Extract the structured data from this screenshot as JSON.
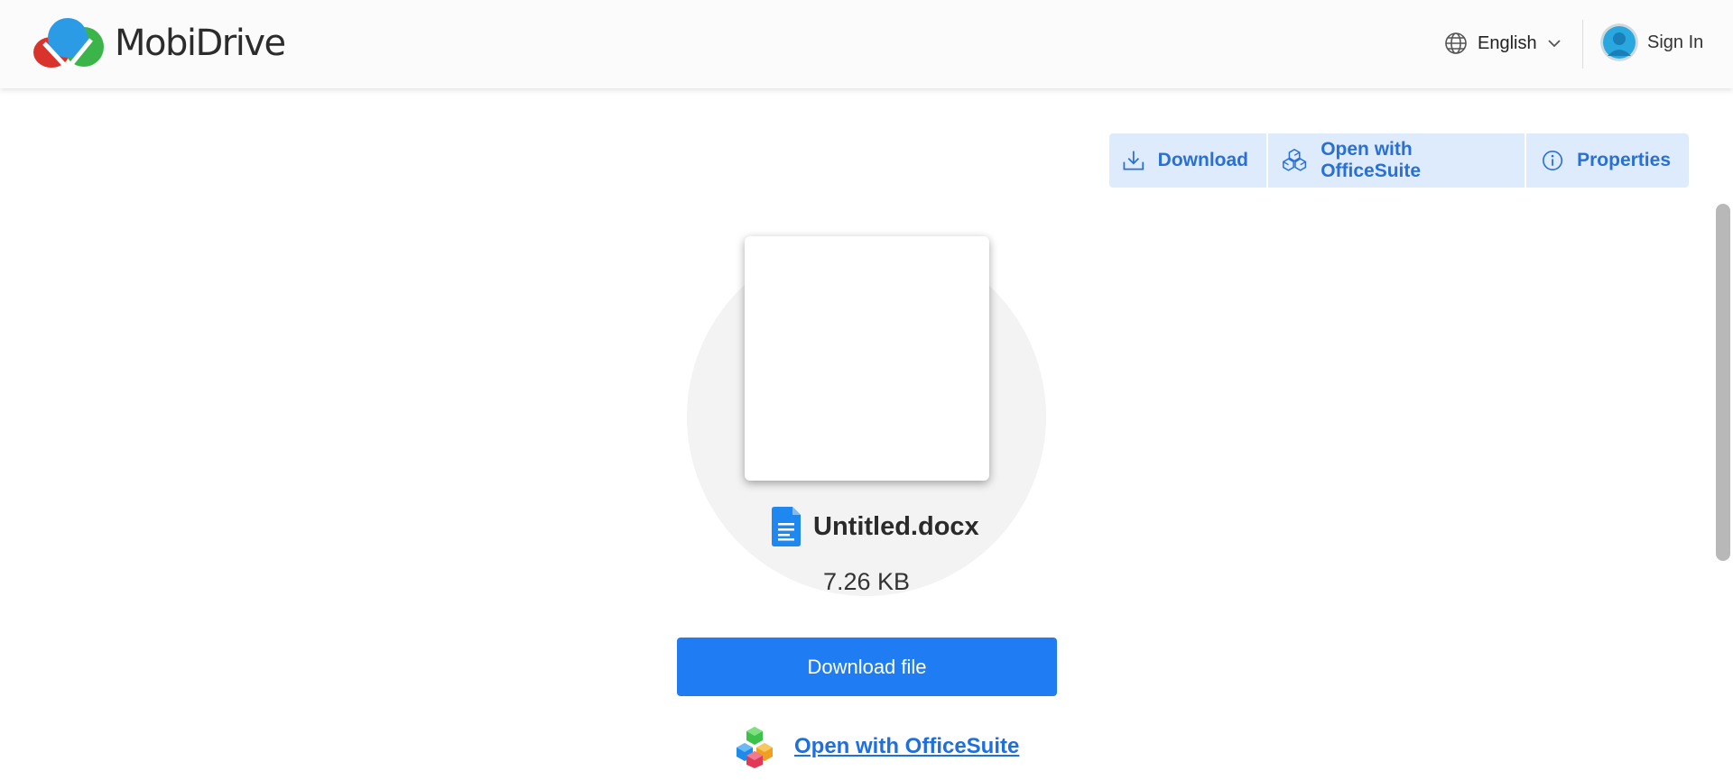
{
  "header": {
    "brand": "MobiDrive",
    "language": "English",
    "sign_in": "Sign In"
  },
  "toolbar": {
    "download": "Download",
    "open_with": "Open with OfficeSuite",
    "properties": "Properties"
  },
  "file": {
    "name": "Untitled.docx",
    "size": "7.26 KB"
  },
  "actions": {
    "download_file": "Download file",
    "open_with_officesuite": "Open with OfficeSuite"
  },
  "colors": {
    "accent": "#1f7cf3",
    "toolbar_bg": "#deebfc",
    "toolbar_text": "#2970d4",
    "link": "#1f6fdc"
  },
  "icons": {
    "logo": "mobidrive-logo-icon",
    "language": "globe-icon",
    "dropdown": "chevron-down-icon",
    "avatar": "user-avatar-icon",
    "download": "download-icon",
    "officesuite": "officesuite-icon",
    "properties": "info-icon",
    "file_type": "docx-file-icon"
  }
}
